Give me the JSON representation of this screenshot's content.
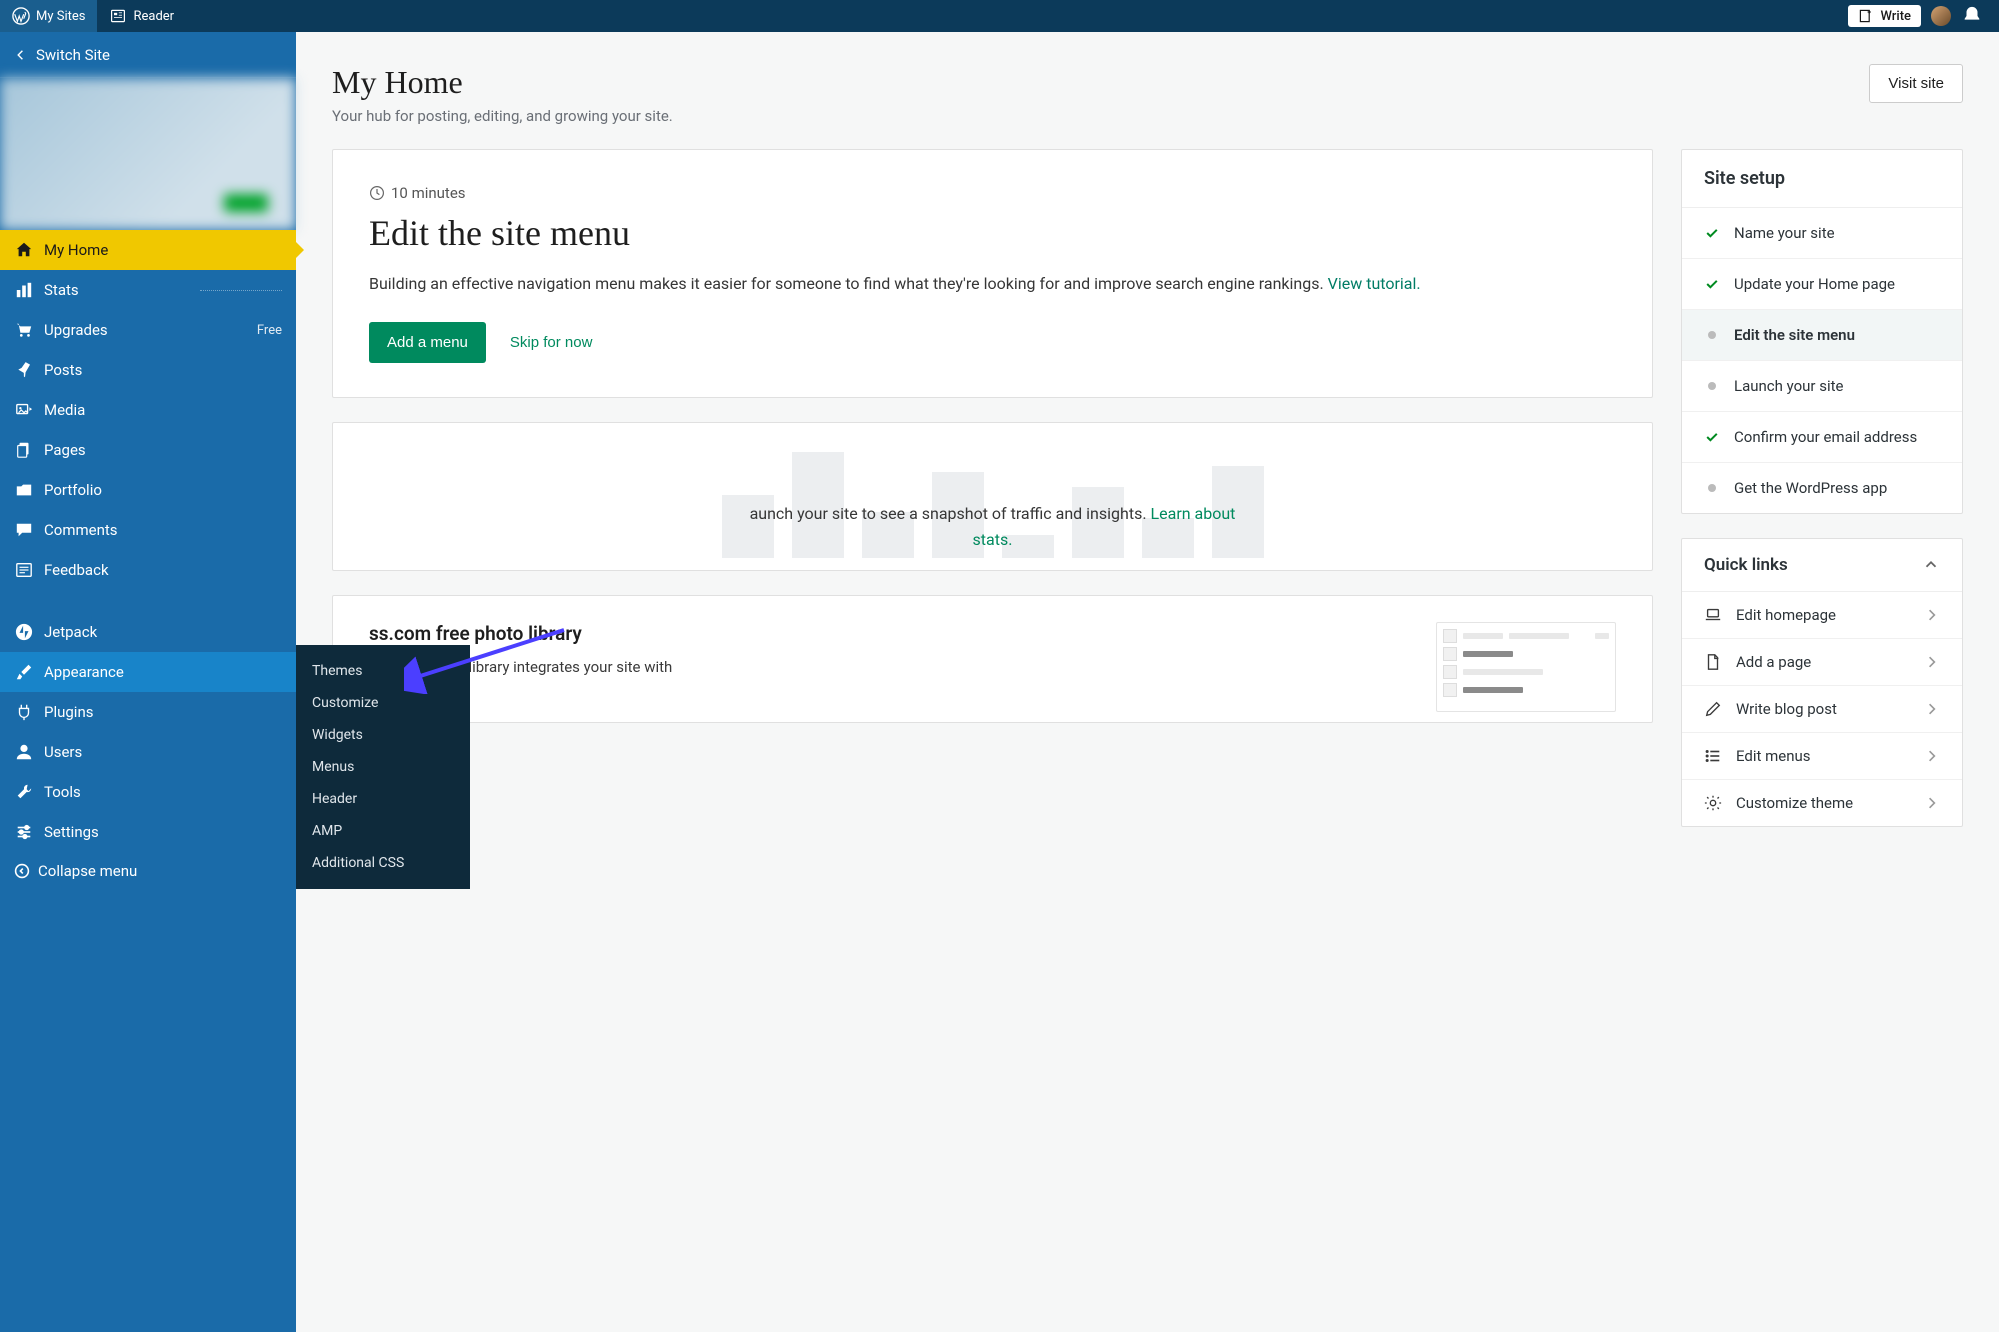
{
  "topbar": {
    "my_sites": "My Sites",
    "reader": "Reader",
    "write": "Write"
  },
  "sidebar": {
    "switch_site": "Switch Site",
    "items": [
      {
        "label": "My Home"
      },
      {
        "label": "Stats"
      },
      {
        "label": "Upgrades",
        "badge": "Free"
      },
      {
        "label": "Posts"
      },
      {
        "label": "Media"
      },
      {
        "label": "Pages"
      },
      {
        "label": "Portfolio"
      },
      {
        "label": "Comments"
      },
      {
        "label": "Feedback"
      },
      {
        "label": "Jetpack"
      },
      {
        "label": "Appearance"
      },
      {
        "label": "Plugins"
      },
      {
        "label": "Users"
      },
      {
        "label": "Tools"
      },
      {
        "label": "Settings"
      }
    ],
    "collapse": "Collapse menu",
    "flyout": [
      "Themes",
      "Customize",
      "Widgets",
      "Menus",
      "Header",
      "AMP",
      "Additional CSS"
    ]
  },
  "header": {
    "title": "My Home",
    "subtitle": "Your hub for posting, editing, and growing your site.",
    "visit": "Visit site"
  },
  "task": {
    "minutes": "10 minutes",
    "title": "Edit the site menu",
    "desc_a": "Building an effective navigation menu makes it easier for someone to find what they're looking for and improve search engine rankings. ",
    "desc_link": "View tutorial.",
    "primary": "Add a menu",
    "skip": "Skip for now"
  },
  "stats": {
    "text_a": "aunch your site to see a snapshot of traffic and insights. ",
    "text_link": "Learn about stats."
  },
  "photo": {
    "title_suffix": "ss.com free photo library",
    "desc": "Our free photo library integrates your site with"
  },
  "setup": {
    "title": "Site setup",
    "items": [
      {
        "label": "Name your site",
        "done": true
      },
      {
        "label": "Update your Home page",
        "done": true
      },
      {
        "label": "Edit the site menu",
        "active": true
      },
      {
        "label": "Launch your site"
      },
      {
        "label": "Confirm your email address",
        "done": true
      },
      {
        "label": "Get the WordPress app"
      }
    ]
  },
  "quick": {
    "title": "Quick links",
    "items": [
      {
        "label": "Edit homepage"
      },
      {
        "label": "Add a page"
      },
      {
        "label": "Write blog post"
      },
      {
        "label": "Edit menus"
      },
      {
        "label": "Customize theme"
      }
    ]
  }
}
